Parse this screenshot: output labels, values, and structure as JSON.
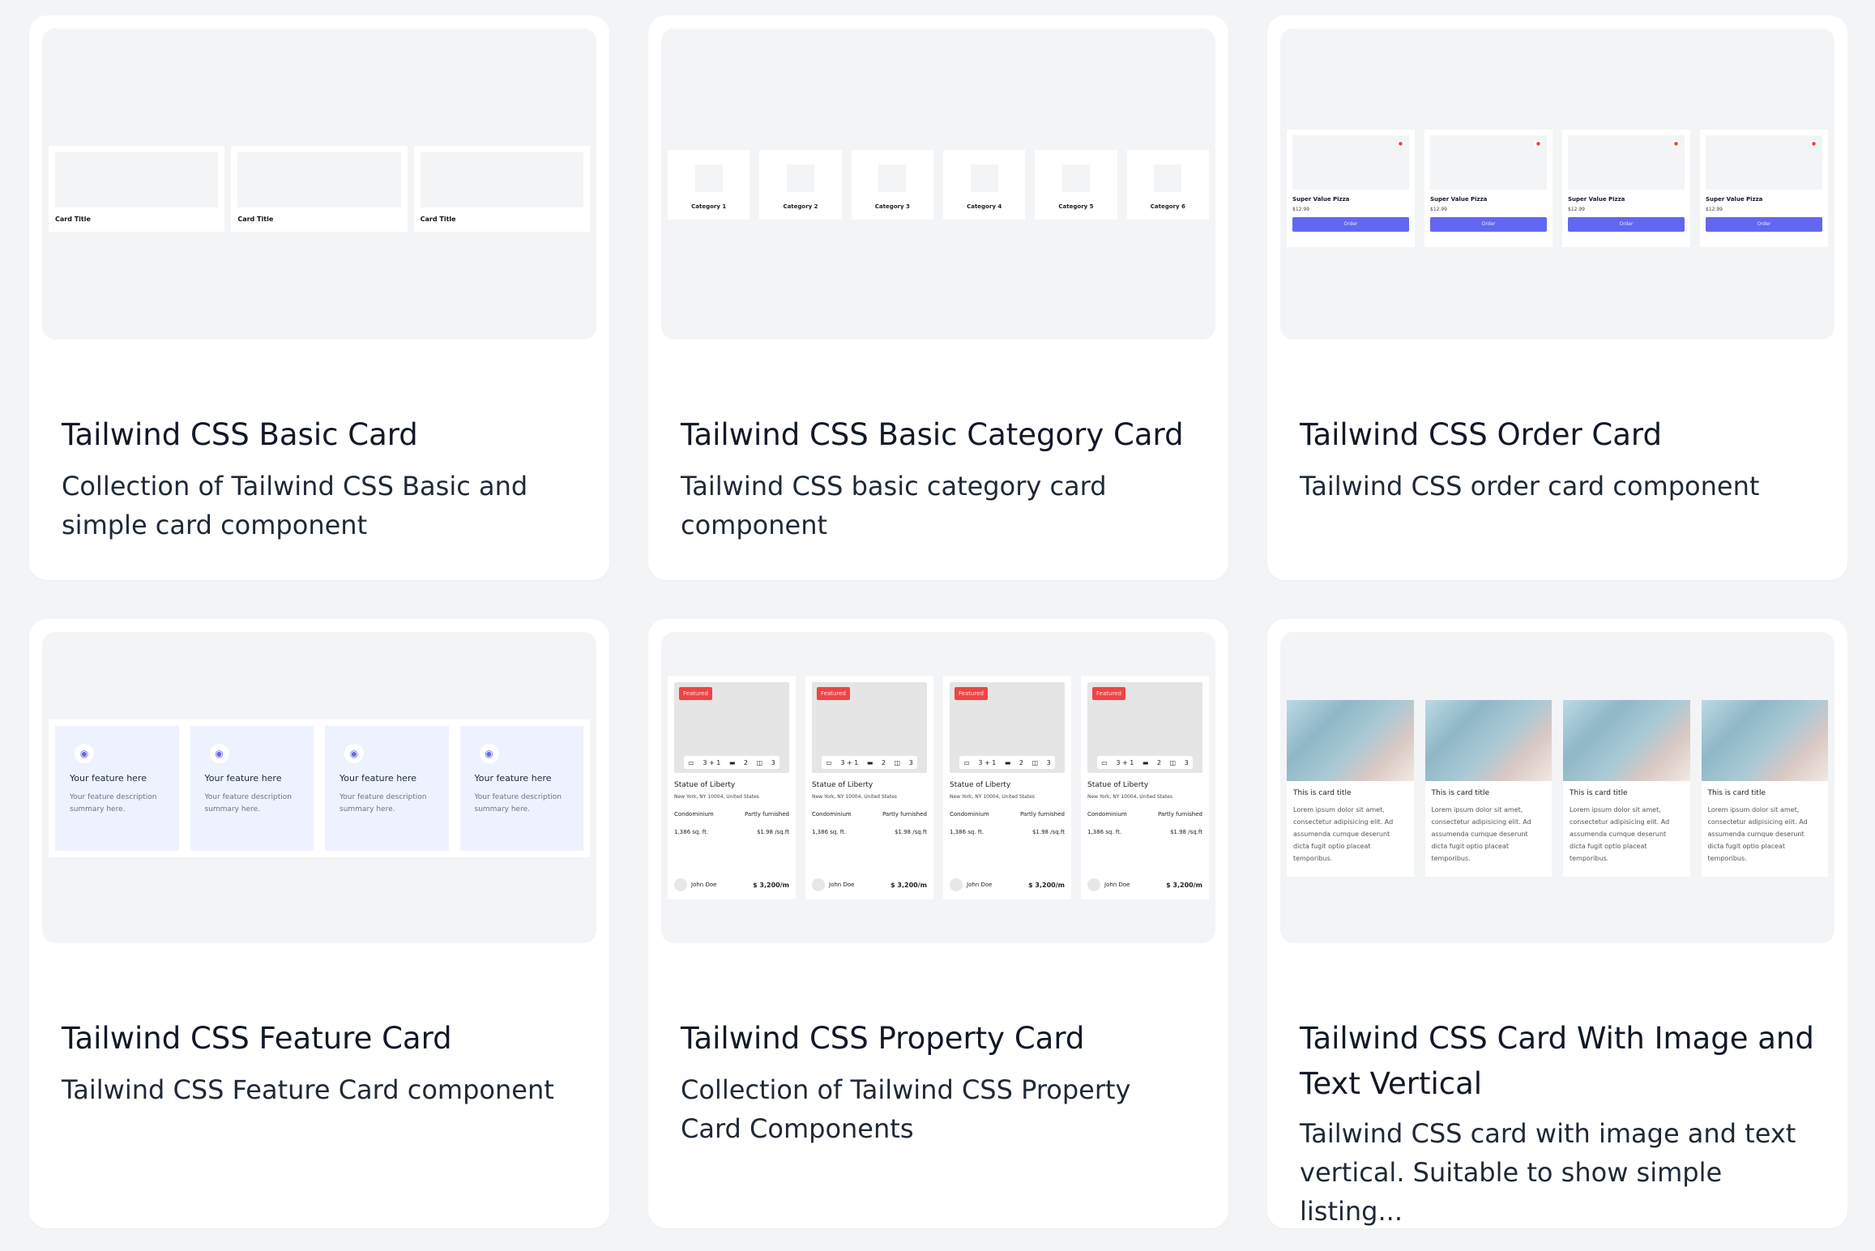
{
  "cards": [
    {
      "title": "Tailwind CSS Basic Card",
      "description": "Collection of Tailwind CSS Basic and simple card component"
    },
    {
      "title": "Tailwind CSS Basic Category Card",
      "description": "Tailwind CSS basic category card component"
    },
    {
      "title": "Tailwind CSS Order Card",
      "description": "Tailwind CSS order card component"
    },
    {
      "title": "Tailwind CSS Feature Card",
      "description": "Tailwind CSS Feature Card component"
    },
    {
      "title": "Tailwind CSS Property Card",
      "description": "Collection of Tailwind CSS Property Card Components"
    },
    {
      "title": "Tailwind CSS Card With Image and Text Vertical",
      "description": "Tailwind CSS card with image and text vertical. Suitable to show simple listing..."
    }
  ],
  "basic_preview": {
    "item_title": "Card Title"
  },
  "category_preview": {
    "items": [
      "Category 1",
      "Category 2",
      "Category 3",
      "Category 4",
      "Category 5",
      "Category 6"
    ]
  },
  "order_preview": {
    "name": "Super Value Pizza",
    "price": "$12.99",
    "button": "Order",
    "badge_icon": "fire-icon"
  },
  "feature_preview": {
    "title": "Your feature here",
    "desc": "Your feature description summary here.",
    "icon": "piggy-bank-icon"
  },
  "property_preview": {
    "badge": "Featured",
    "beds": "3 + 1",
    "cars": "2",
    "baths": "3",
    "name": "Statue of Liberty",
    "address": "New York, NY 10004, United States",
    "type": "Condominium",
    "furnish": "Partly furnished",
    "area": "1,386 sq. ft.",
    "price_sqft": "$1.98 /sq.ft",
    "agent": "John Doe",
    "price": "$ 3,200/m"
  },
  "image_preview": {
    "title": "This is card title",
    "desc": "Lorem ipsum dolor sit amet, consectetur adipisicing elit. Ad assumenda cumque deserunt dicta fugit optio placeat temporibus."
  },
  "colors": {
    "accent": "#6366f1",
    "badge": "#ef4444",
    "feature_bg": "#eef2ff",
    "preview_bg": "#f3f4f6"
  }
}
